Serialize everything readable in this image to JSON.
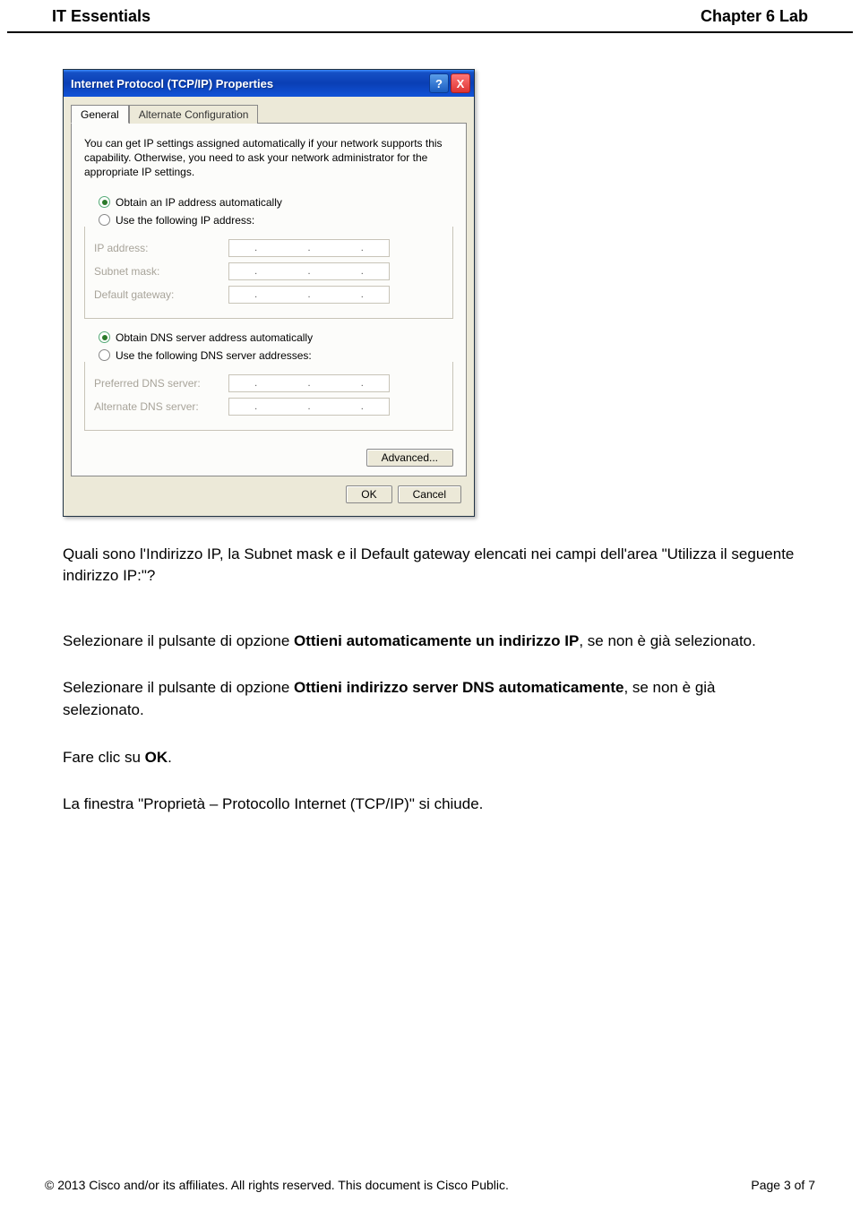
{
  "header": {
    "left": "IT Essentials",
    "right": "Chapter 6 Lab"
  },
  "dialog": {
    "title": "Internet Protocol (TCP/IP) Properties",
    "help_glyph": "?",
    "close_glyph": "X",
    "tabs": {
      "general": "General",
      "alternate": "Alternate Configuration"
    },
    "description": "You can get IP settings assigned automatically if your network supports this capability. Otherwise, you need to ask your network administrator for the appropriate IP settings.",
    "ip_section": {
      "auto_label": "Obtain an IP address automatically",
      "manual_label": "Use the following IP address:",
      "ip_address_label": "IP address:",
      "subnet_label": "Subnet mask:",
      "gateway_label": "Default gateway:"
    },
    "dns_section": {
      "auto_label": "Obtain DNS server address automatically",
      "manual_label": "Use the following DNS server addresses:",
      "preferred_label": "Preferred DNS server:",
      "alternate_label": "Alternate DNS server:"
    },
    "advanced_btn": "Advanced...",
    "ok_btn": "OK",
    "cancel_btn": "Cancel"
  },
  "body": {
    "q1": "Quali sono l'Indirizzo IP, la Subnet mask e il Default gateway elencati nei campi dell'area \"Utilizza il seguente indirizzo IP:\"?",
    "p2a": "Selezionare il pulsante di opzione ",
    "p2b": "Ottieni automaticamente un indirizzo IP",
    "p2c": ", se non è già selezionato.",
    "p3a": "Selezionare il pulsante di opzione ",
    "p3b": "Ottieni indirizzo server DNS automaticamente",
    "p3c": ", se non è già selezionato.",
    "p4a": "Fare clic su ",
    "p4b": "OK",
    "p4c": ".",
    "p5": "La finestra \"Proprietà – Protocollo Internet (TCP/IP)\" si chiude."
  },
  "footer": {
    "copyright": "© 2013 Cisco and/or its affiliates. All rights reserved. This document is Cisco Public.",
    "page": "Page 3 of 7"
  }
}
